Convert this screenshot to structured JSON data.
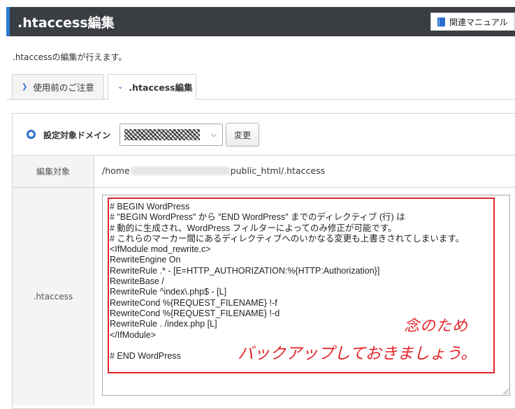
{
  "header": {
    "title": ".htaccess編集",
    "manual_label": "関連マニュアル",
    "accent_color": "#2d7bd2",
    "bg_color": "#3a3d42"
  },
  "description": ".htaccessの編集が行えます。",
  "tabs": [
    {
      "label": "使用前のご注意",
      "icon": "chevron-right-icon",
      "active": false
    },
    {
      "label": ".htaccess編集",
      "icon": "chevron-down-icon",
      "active": true
    }
  ],
  "domain": {
    "label": "設定対象ドメイン",
    "selected_value": "",
    "change_label": "変更"
  },
  "target": {
    "label": "編集対象",
    "path_prefix": "/home",
    "path_suffix": "public_html/.htaccess"
  },
  "htaccess": {
    "label": ".htaccess",
    "lines": [
      "# BEGIN WordPress",
      "# \"BEGIN WordPress\" から \"END WordPress\" までのディレクティブ (行) は",
      "# 動的に生成され、WordPress フィルターによってのみ修正が可能です。",
      "# これらのマーカー間にあるディレクティブへのいかなる変更も上書きされてしまいます。",
      "<IfModule mod_rewrite.c>",
      "RewriteEngine On",
      "RewriteRule .* - [E=HTTP_AUTHORIZATION:%{HTTP:Authorization}]",
      "RewriteBase /",
      "RewriteRule ^index\\.php$ - [L]",
      "RewriteCond %{REQUEST_FILENAME} !-f",
      "RewriteCond %{REQUEST_FILENAME} !-d",
      "RewriteRule . /index.php [L]",
      "</IfModule>",
      "",
      "# END WordPress"
    ]
  },
  "annotation": {
    "line1": "念のため",
    "line2": "バックアップしておきましょう。",
    "color": "#e3262b"
  }
}
